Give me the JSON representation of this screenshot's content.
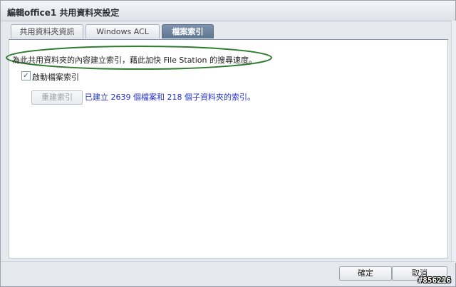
{
  "window": {
    "title": "編輯office1 共用資料夾設定"
  },
  "tabs": [
    {
      "label": "共用資料夾資訊",
      "active": false
    },
    {
      "label": "Windows ACL",
      "active": false
    },
    {
      "label": "檔案索引",
      "active": true
    }
  ],
  "content": {
    "description": "為此共用資料夾的內容建立索引，藉此加快 File Station 的搜尋速度。",
    "enable_index": {
      "label": "啟動檔案索引",
      "checked": true
    },
    "rebuild_button": "重建索引",
    "status": "已建立 2639 個檔案和 218 個子資料夾的索引。"
  },
  "footer": {
    "ok": "確定",
    "cancel": "取消"
  },
  "watermark": "#856216",
  "colors": {
    "active_tab": "#6b819b",
    "status_text": "#2233cc",
    "annotation_ellipse": "#2e7d2e"
  }
}
